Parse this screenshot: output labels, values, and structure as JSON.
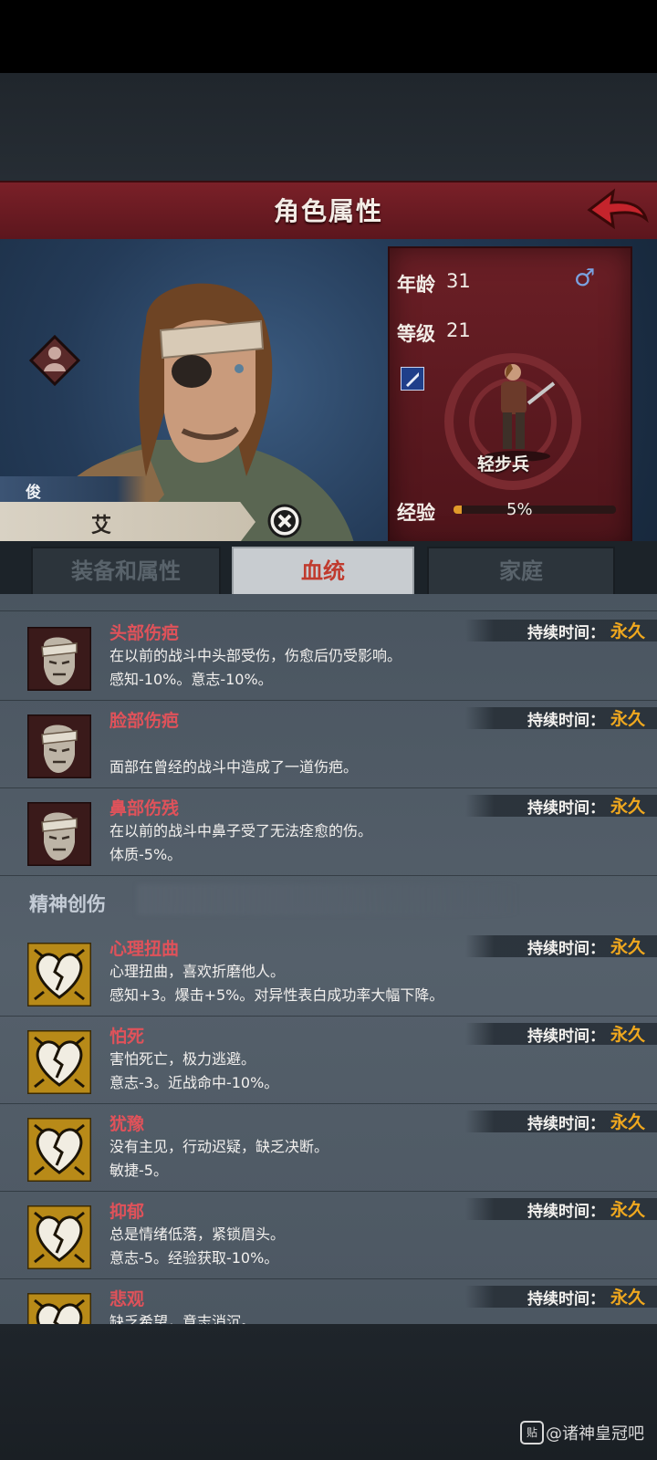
{
  "header": {
    "title": "角色属性"
  },
  "character": {
    "nickname": "俊朗的",
    "name": "艾丹",
    "age_label": "年龄",
    "age": "31",
    "level_label": "等级",
    "level": "21",
    "gender_symbol": "♂",
    "class_name": "轻步兵",
    "exp_label": "经验",
    "exp_percent_text": "5%",
    "exp_fraction": 0.05
  },
  "tabs": [
    {
      "label": "装备和属性",
      "active": false
    },
    {
      "label": "血统",
      "active": true
    },
    {
      "label": "家庭",
      "active": false
    }
  ],
  "duration_label": "持续时间：",
  "traits_physical": [
    {
      "title": "头部伤疤",
      "line1": "在以前的战斗中头部受伤，伤愈后仍受影响。",
      "line2": "感知-10%。意志-10%。",
      "duration": "永久",
      "icon": "scarred-head-icon"
    },
    {
      "title": "脸部伤疤",
      "line1": "",
      "line2": "面部在曾经的战斗中造成了一道伤疤。",
      "duration": "永久",
      "icon": "scarred-face-icon"
    },
    {
      "title": "鼻部伤残",
      "line1": "在以前的战斗中鼻子受了无法痊愈的伤。",
      "line2": "体质-5%。",
      "duration": "永久",
      "icon": "injured-nose-icon"
    }
  ],
  "section_mental": "精神创伤",
  "traits_mental": [
    {
      "title": "心理扭曲",
      "line1": "心理扭曲，喜欢折磨他人。",
      "line2": "感知+3。爆击+5%。对异性表白成功率大幅下降。",
      "duration": "永久",
      "icon": "broken-heart-icon"
    },
    {
      "title": "怕死",
      "line1": "害怕死亡，极力逃避。",
      "line2": "意志-3。近战命中-10%。",
      "duration": "永久",
      "icon": "broken-heart-icon"
    },
    {
      "title": "犹豫",
      "line1": "没有主见，行动迟疑，缺乏决断。",
      "line2": "敏捷-5。",
      "duration": "永久",
      "icon": "broken-heart-icon"
    },
    {
      "title": "抑郁",
      "line1": "总是情绪低落，紧锁眉头。",
      "line2": "意志-5。经验获取-10%。",
      "duration": "永久",
      "icon": "broken-heart-icon"
    },
    {
      "title": "悲观",
      "line1": "缺乏希望，意志消沉。",
      "line2": "",
      "duration": "永久",
      "icon": "broken-heart-icon"
    }
  ],
  "watermark": {
    "icon_text": "贴",
    "text": "@诸神皇冠吧"
  },
  "colors": {
    "header_red": "#6b1a22",
    "title_red": "#e0525a",
    "duration_orange": "#f0a81e",
    "tab_active_text": "#c03b2e"
  }
}
